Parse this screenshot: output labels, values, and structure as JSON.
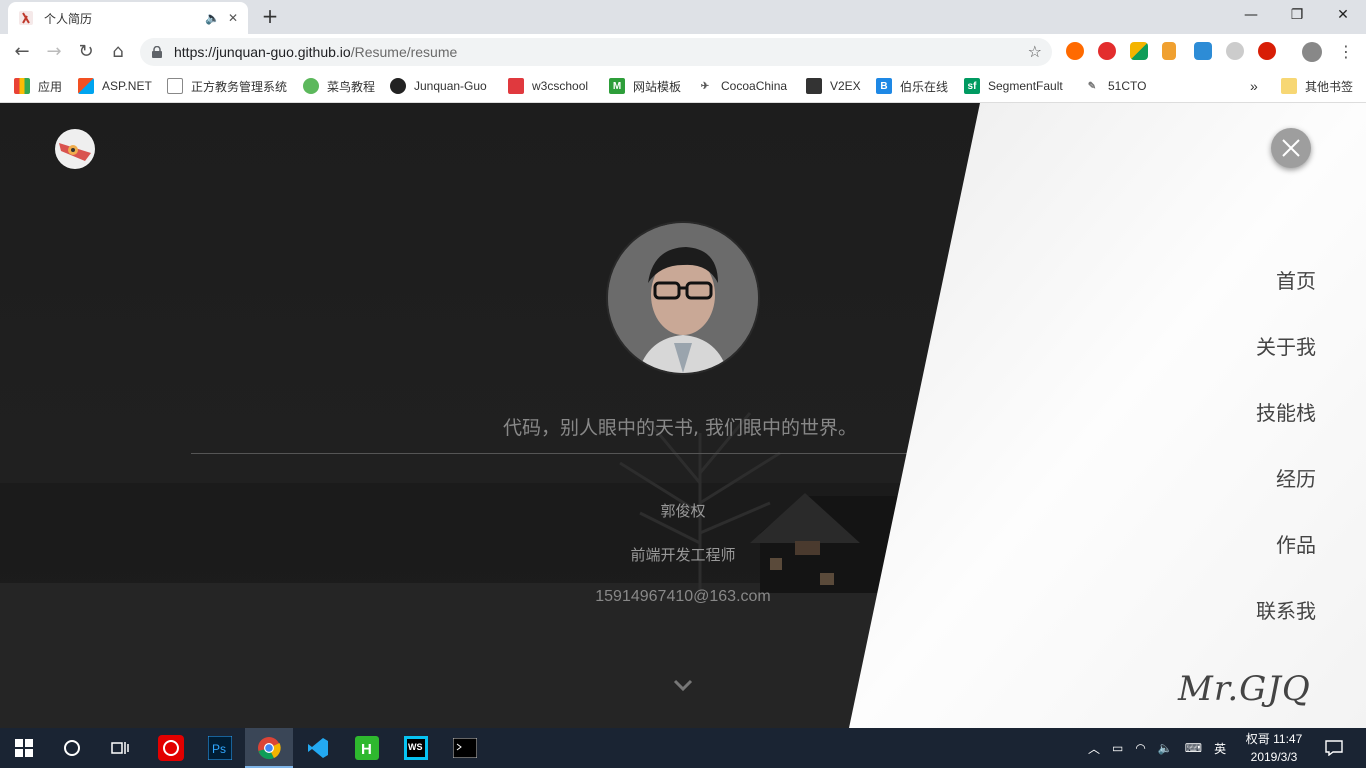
{
  "browser": {
    "tab": {
      "title": "个人简历"
    },
    "url": {
      "host": "https://junquan-guo.github.io",
      "path": "/Resume/resume"
    },
    "bookmarks": [
      {
        "label": "应用",
        "icon": "apps-grid-icon",
        "color": "#e94235"
      },
      {
        "label": "ASP.NET",
        "icon": "windows-icon",
        "color": "#f25022"
      },
      {
        "label": "正方教务管理系统",
        "icon": "page-icon",
        "color": "#888888"
      },
      {
        "label": "菜鸟教程",
        "icon": "runoob-icon",
        "color": "#5cb85c"
      },
      {
        "label": "Junquan-Guo",
        "icon": "github-icon",
        "color": "#222222"
      },
      {
        "label": "w3cschool",
        "icon": "w3cschool-icon",
        "color": "#e0393e"
      },
      {
        "label": "网站模板",
        "icon": "m-icon",
        "color": "#2e9e3a"
      },
      {
        "label": "CocoaChina",
        "icon": "cocoachina-icon",
        "color": "#555555"
      },
      {
        "label": "V2EX",
        "icon": "v2ex-icon",
        "color": "#333333"
      },
      {
        "label": "伯乐在线",
        "icon": "jobbole-icon",
        "color": "#1e88e5"
      },
      {
        "label": "SegmentFault",
        "icon": "segmentfault-icon",
        "color": "#009a61"
      },
      {
        "label": "51CTO",
        "icon": "51cto-icon",
        "color": "#777777"
      }
    ],
    "bookmarks_overflow": "»",
    "other_bookmarks": "其他书签"
  },
  "page": {
    "slogan": "代码，别人眼中的天书, 我们眼中的世界。",
    "name": "郭俊权",
    "role": "前端开发工程师",
    "email": "15914967410@163.com",
    "menu": [
      "首页",
      "关于我",
      "技能栈",
      "经历",
      "作品",
      "联系我"
    ],
    "signature": "Mr.GJQ"
  },
  "taskbar": {
    "ime": "英",
    "user": "权哥",
    "time": "11:47",
    "date": "2019/3/3"
  }
}
